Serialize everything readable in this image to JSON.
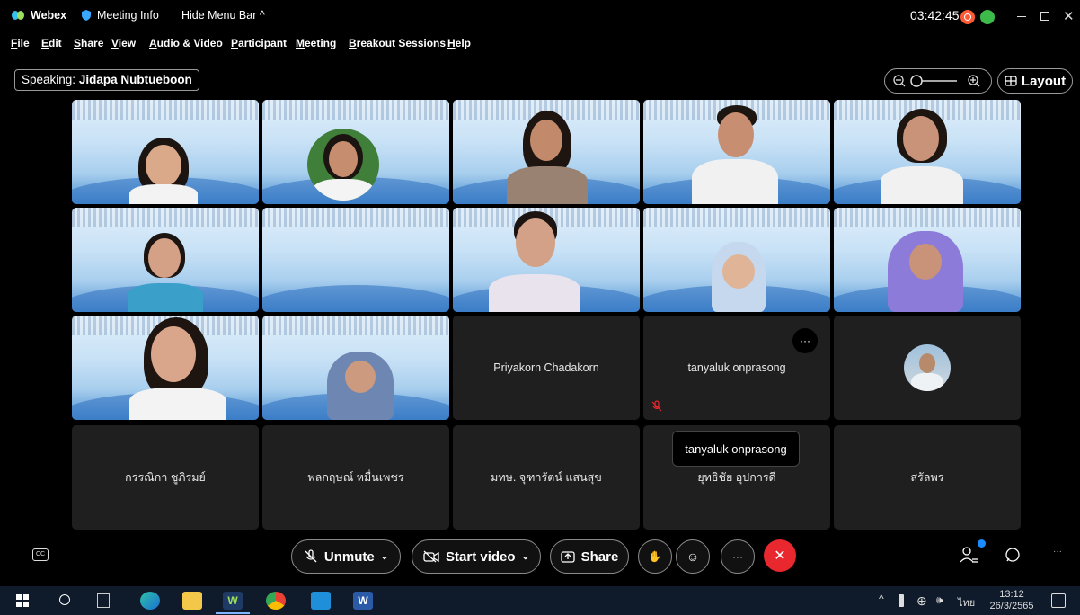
{
  "titlebar": {
    "app_name": "Webex",
    "meeting_info": "Meeting Info",
    "hide_menu": "Hide Menu Bar ^",
    "clock": "03:42:45"
  },
  "menu": [
    "File",
    "Edit",
    "Share",
    "View",
    "Audio & Video",
    "Participant",
    "Meeting",
    "Breakout Sessions",
    "Help"
  ],
  "speaking": {
    "prefix": "Speaking:",
    "name": "Jidapa Nubtueboon"
  },
  "layout_label": "Layout",
  "tiles": [
    {
      "name": ""
    },
    {
      "name": ""
    },
    {
      "name": ""
    },
    {
      "name": ""
    },
    {
      "name": ""
    },
    {
      "name": ""
    },
    {
      "name": ""
    },
    {
      "name": ""
    },
    {
      "name": ""
    },
    {
      "name": ""
    },
    {
      "name": ""
    },
    {
      "name": ""
    },
    {
      "name": "Priyakorn Chadakorn"
    },
    {
      "name": "tanyaluk onprasong"
    },
    {
      "name": ""
    },
    {
      "name": "กรรณิกา ชูภิรมย์"
    },
    {
      "name": "พลกฤษณ์ หมื่นเพชร"
    },
    {
      "name": "มทษ. จุฑารัตน์ แสนสุข"
    },
    {
      "name": "ยุทธิชัย อุปการดี"
    },
    {
      "name": "สรัลพร"
    }
  ],
  "tooltip": "tanyaluk onprasong",
  "controls": {
    "unmute": "Unmute",
    "start_video": "Start video",
    "share": "Share"
  },
  "taskbar": {
    "lang": "ไทย",
    "time": "13:12",
    "date": "26/3/2565"
  },
  "colors": {
    "end_call": "#e8272e",
    "accent": "#1a8cff"
  }
}
